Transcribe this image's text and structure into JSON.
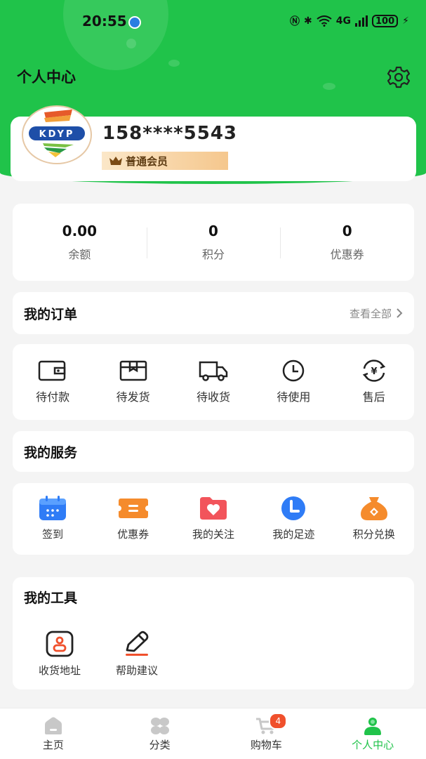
{
  "status_bar": {
    "time": "20:55",
    "network": "4G",
    "battery": "100"
  },
  "header": {
    "title": "个人中心"
  },
  "profile": {
    "logo_text": "KDYP",
    "phone": "158****5543",
    "member_level": "普通会员"
  },
  "stats": [
    {
      "value": "0.00",
      "label": "余额"
    },
    {
      "value": "0",
      "label": "积分"
    },
    {
      "value": "0",
      "label": "优惠券"
    }
  ],
  "orders": {
    "title": "我的订单",
    "view_all": "查看全部",
    "items": [
      {
        "label": "待付款",
        "icon": "wallet-icon"
      },
      {
        "label": "待发货",
        "icon": "package-icon"
      },
      {
        "label": "待收货",
        "icon": "truck-icon"
      },
      {
        "label": "待使用",
        "icon": "clock-icon"
      },
      {
        "label": "售后",
        "icon": "refund-icon"
      }
    ]
  },
  "services": {
    "title": "我的服务",
    "items": [
      {
        "label": "签到",
        "icon": "calendar-icon",
        "color": "#2f7cf6"
      },
      {
        "label": "优惠券",
        "icon": "coupon-icon",
        "color": "#f58b2c"
      },
      {
        "label": "我的关注",
        "icon": "heart-folder-icon",
        "color": "#f2545b"
      },
      {
        "label": "我的足迹",
        "icon": "footprint-clock-icon",
        "color": "#2f7cf6"
      },
      {
        "label": "积分兑换",
        "icon": "money-bag-icon",
        "color": "#f58b2c"
      }
    ]
  },
  "tools": {
    "title": "我的工具",
    "items": [
      {
        "label": "收货地址",
        "icon": "address-icon"
      },
      {
        "label": "帮助建议",
        "icon": "pen-icon"
      }
    ]
  },
  "tabbar": {
    "items": [
      {
        "label": "主页",
        "icon": "home-icon"
      },
      {
        "label": "分类",
        "icon": "category-icon"
      },
      {
        "label": "购物车",
        "icon": "cart-icon",
        "badge": "4"
      },
      {
        "label": "个人中心",
        "icon": "user-icon",
        "active": true
      }
    ]
  },
  "colors": {
    "brand": "#20c34a",
    "badge": "#f0502c",
    "member_text": "#5d3b12"
  }
}
